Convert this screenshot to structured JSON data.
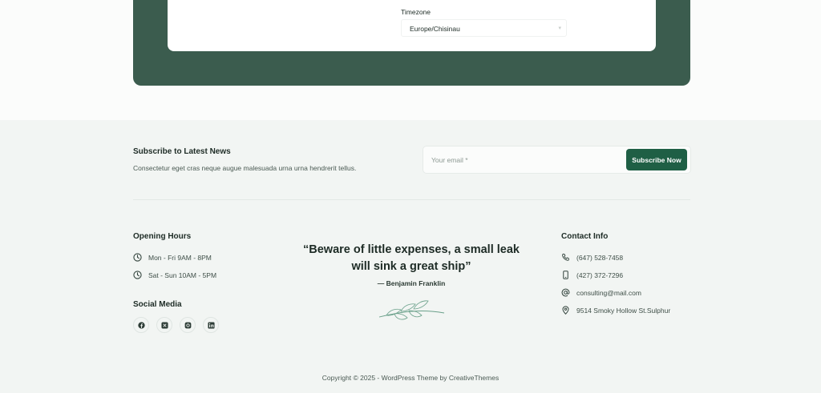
{
  "settings": {
    "timezone_label": "Timezone",
    "timezone_value": "Europe/Chisinau"
  },
  "subscribe": {
    "title": "Subscribe to Latest News",
    "description": "Consectetur eget cras neque augue malesuada urna urna hendrerit tellus.",
    "email_placeholder": "Your email *",
    "button_label": "Subscribe Now"
  },
  "opening_hours": {
    "title": "Opening Hours",
    "items": [
      "Mon - Fri 9AM - 8PM",
      "Sat - Sun 10AM - 5PM"
    ]
  },
  "social_media": {
    "title": "Social Media",
    "icons": [
      "facebook-icon",
      "x-icon",
      "instagram-icon",
      "linkedin-icon"
    ]
  },
  "quote": {
    "text": "“Beware of little expenses, a small leak will sink a great ship”",
    "author": "— Benjamin Franklin"
  },
  "contact": {
    "title": "Contact Info",
    "phone1": "(647) 528-7458",
    "phone2": "(427) 372-7296",
    "email": "consulting@mail.com",
    "address": "9514 Smoky Hollow St.Sulphur"
  },
  "footer": {
    "copyright": "Copyright © 2025 - WordPress Theme by CreativeThemes"
  },
  "colors": {
    "brand_green": "#1f5f45",
    "card_green": "#3b5c4e",
    "footer_bg": "#f2f5f3"
  }
}
